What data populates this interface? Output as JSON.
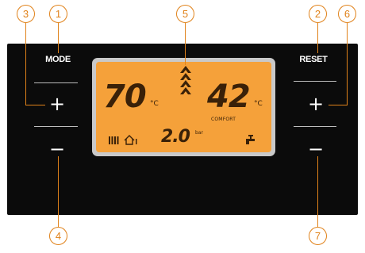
{
  "callouts": {
    "c1": "1",
    "c2": "2",
    "c3": "3",
    "c4": "4",
    "c5": "5",
    "c6": "6",
    "c7": "7"
  },
  "left_panel": {
    "mode_label": "MODE",
    "plus": "+",
    "minus": "−"
  },
  "right_panel": {
    "reset_label": "RESET",
    "plus": "+",
    "minus": "−"
  },
  "lcd": {
    "heating_temp": "70",
    "heating_unit": "°C",
    "dhw_temp": "42",
    "dhw_unit": "°C",
    "comfort_label": "COMFORT",
    "pressure_value": "2.0",
    "pressure_unit": "bar"
  },
  "icons": {
    "flame": "flame-stack-icon",
    "radiator": "radiator-icon",
    "house": "house-icon",
    "tap": "tap-icon"
  },
  "colors": {
    "accent": "#e0821a",
    "lcd_backlight": "#f5a13a",
    "panel": "#0b0b0b"
  }
}
